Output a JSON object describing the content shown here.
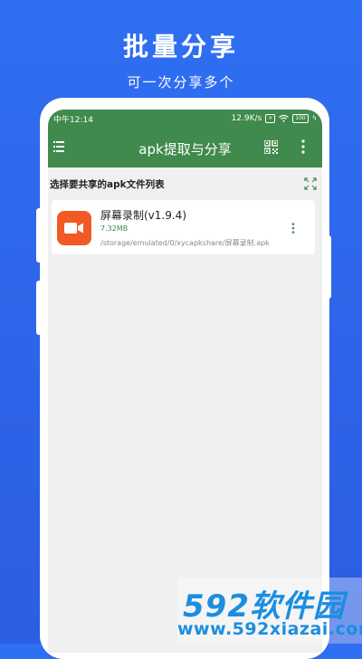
{
  "promo": {
    "title": "批量分享",
    "subtitle": "可一次分享多个"
  },
  "status_bar": {
    "time": "中午12:14",
    "speed": "12.9K/s",
    "battery": "100"
  },
  "app_bar": {
    "title": "apk提取与分享",
    "icons": [
      "menu-icon",
      "qr-code-icon",
      "more-vert-icon"
    ]
  },
  "section": {
    "title": "选择要共享的apk文件列表",
    "icon": "expand-icon"
  },
  "items": [
    {
      "name": "屏幕录制(v1.9.4)",
      "size": "7.32MB",
      "path": "/storage/emulated/0/xycapkshare/屏幕录制.apk",
      "icon": "video-camera-icon",
      "icon_color": "#f15a24"
    }
  ],
  "watermark": {
    "logo": "592软件园",
    "url": "www.592xiazai.com"
  },
  "colors": {
    "background": "#2f6ff2",
    "app_bar": "#3f8a4c",
    "accent_text": "#3f8a4c"
  }
}
